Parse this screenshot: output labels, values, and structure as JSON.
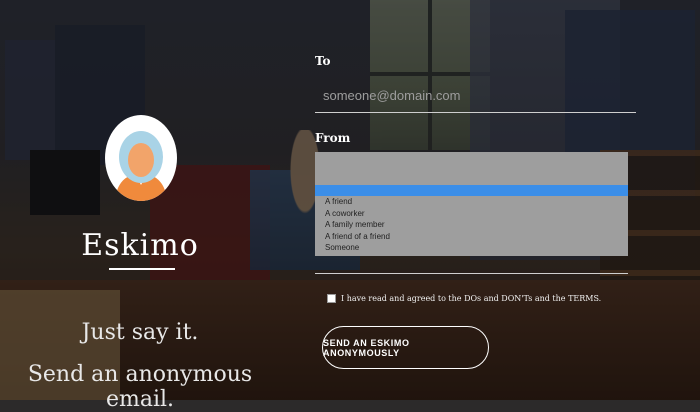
{
  "brand": {
    "name": "Eskimo",
    "tagline_line1": "Just say it.",
    "tagline_line2": "Send an anonymous email."
  },
  "avatar": {
    "icon": "eskimo-avatar-icon",
    "hood_color": "#a9d3e6",
    "face_color": "#f2a46a",
    "body_color": "#f08a3c"
  },
  "form": {
    "to_label": "To",
    "to_placeholder": "someone@domain.com",
    "to_value": "",
    "from_label": "From",
    "from_options": [
      "",
      "A friend",
      "A coworker",
      "A family member",
      "A friend of a friend",
      "Someone"
    ],
    "from_selected_index": 0,
    "agree_text": "I have read and agreed to the DOs and DON'Ts and the TERMS.",
    "agree_checked": false,
    "send_button": "SEND AN ESKIMO ANONYMOUSLY"
  },
  "colors": {
    "select_highlight": "#3b8ee8",
    "select_bg": "#9e9e9e",
    "overlay": "rgba(0,0,0,0.45)"
  }
}
